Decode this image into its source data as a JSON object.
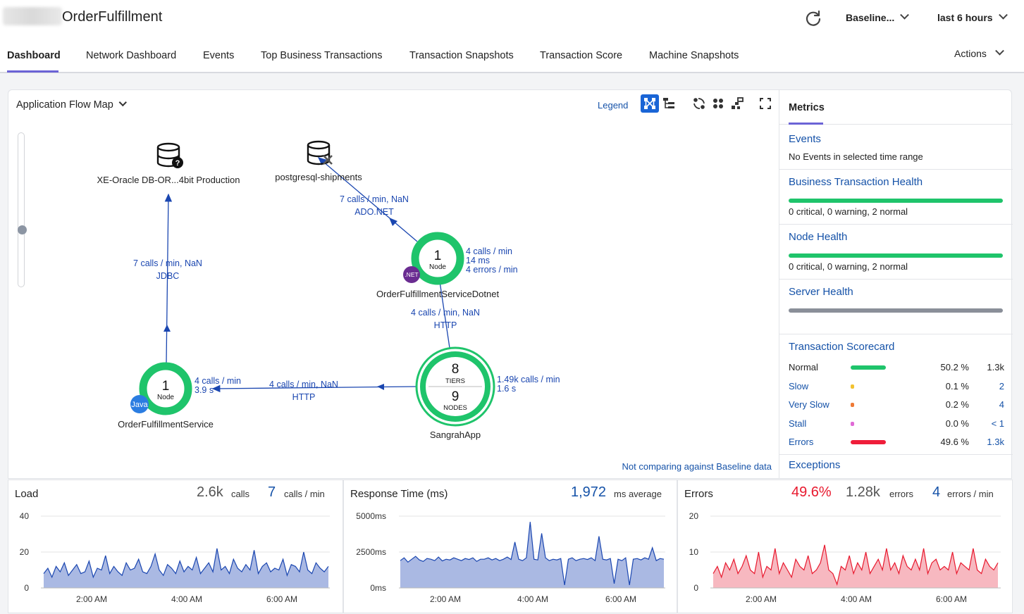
{
  "header": {
    "app_name": "OrderFulfillment",
    "baseline_label": "Baseline...",
    "time_range_label": "last 6 hours"
  },
  "tabs": [
    {
      "label": "Dashboard",
      "active": true
    },
    {
      "label": "Network Dashboard"
    },
    {
      "label": "Events"
    },
    {
      "label": "Top Business Transactions"
    },
    {
      "label": "Transaction Snapshots"
    },
    {
      "label": "Transaction Score"
    },
    {
      "label": "Machine Snapshots"
    }
  ],
  "actions_label": "Actions",
  "flowmap": {
    "title": "Application Flow Map",
    "legend_label": "Legend",
    "baseline_note": "Not comparing against Baseline data",
    "nodes": {
      "oracle_db": {
        "label": "XE-Oracle DB-OR...4bit Production"
      },
      "postgres": {
        "label": "postgresql-shipments"
      },
      "dotnet": {
        "count": "1",
        "unit": "Node",
        "badge": ".NET",
        "label": "OrderFulfillmentServiceDotnet",
        "stats": [
          "4 calls / min",
          "14 ms",
          "4 errors / min"
        ]
      },
      "java": {
        "count": "1",
        "unit": "Node",
        "badge": "Java",
        "label": "OrderFulfillmentService",
        "stats": [
          "4 calls / min",
          "3.9 s"
        ]
      },
      "sangrah": {
        "tiers": "8",
        "tiers_label": "TIERS",
        "nodes": "9",
        "nodes_label": "NODES",
        "label": "SangrahApp",
        "stats": [
          "1.49k calls / min",
          "1.6 s"
        ]
      }
    },
    "edges": {
      "java_to_oracle": [
        "7 calls / min, NaN",
        "JDBC"
      ],
      "dotnet_to_postgres": [
        "7 calls / min, NaN",
        "ADO.NET"
      ],
      "sangrah_to_dotnet": [
        "4 calls / min, NaN",
        "HTTP"
      ],
      "sangrah_to_java": [
        "4 calls / min, NaN",
        "HTTP"
      ]
    }
  },
  "metrics": {
    "header": "Metrics",
    "events": {
      "title": "Events",
      "subtitle": "No Events in selected time range"
    },
    "bt_health": {
      "title": "Business Transaction Health",
      "subtitle": "0 critical, 0 warning, 2 normal",
      "color": "#1fc46b"
    },
    "node_health": {
      "title": "Node Health",
      "subtitle": "0 critical, 0 warning, 2 normal",
      "color": "#1fc46b"
    },
    "server_health": {
      "title": "Server Health",
      "color": "#8a8f99"
    },
    "scorecard": {
      "title": "Transaction Scorecard",
      "rows": [
        {
          "name": "Normal",
          "percent": "50.2 %",
          "count": "1.3k",
          "color": "#1fc46b",
          "bar": 0.502
        },
        {
          "name": "Slow",
          "percent": "0.1 %",
          "count": "2",
          "color": "#f2c230",
          "bar": 0.001
        },
        {
          "name": "Very Slow",
          "percent": "0.2 %",
          "count": "4",
          "color": "#ef7a36",
          "bar": 0.002
        },
        {
          "name": "Stall",
          "percent": "0.0 %",
          "count": "< 1",
          "color": "#e06ad6",
          "bar": 0.0
        },
        {
          "name": "Errors",
          "percent": "49.6 %",
          "count": "1.3k",
          "color": "#ef1d3a",
          "bar": 0.496
        }
      ]
    },
    "exceptions": {
      "title": "Exceptions"
    }
  },
  "bottom": {
    "load": {
      "title": "Load",
      "total": "2.6k",
      "total_unit": "calls",
      "rate": "7",
      "rate_unit": "calls / min",
      "y_ticks": [
        "40",
        "20",
        "0"
      ],
      "x_ticks": [
        "2:00 AM",
        "4:00 AM",
        "6:00 AM"
      ],
      "color": "#1a46b0",
      "fill": "#aab9e3"
    },
    "response": {
      "title": "Response Time (ms)",
      "avg": "1,972",
      "avg_unit": "ms average",
      "y_ticks": [
        "5000ms",
        "2500ms",
        "0ms"
      ],
      "x_ticks": [
        "2:00 AM",
        "4:00 AM",
        "6:00 AM"
      ],
      "color": "#1a46b0",
      "fill": "#aab9e3"
    },
    "errors": {
      "title": "Errors",
      "percent": "49.6%",
      "total": "1.28k",
      "total_unit": "errors",
      "rate": "4",
      "rate_unit": "errors / min",
      "y_ticks": [
        "20",
        "10",
        "0"
      ],
      "x_ticks": [
        "2:00 AM",
        "4:00 AM",
        "6:00 AM"
      ],
      "color": "#e8192e",
      "fill": "#f7b8c0"
    }
  },
  "chart_data": [
    {
      "type": "area",
      "title": "Load",
      "ylim": [
        0,
        40
      ],
      "ylabel": "",
      "x_ticks": [
        "2:00 AM",
        "4:00 AM",
        "6:00 AM"
      ],
      "series": [
        {
          "values": [
            8,
            11,
            6,
            12,
            9,
            14,
            7,
            10,
            13,
            8,
            9,
            15,
            6,
            11,
            10,
            18,
            8,
            12,
            9,
            7,
            14,
            10,
            11,
            16,
            9,
            8,
            12,
            19,
            10,
            7,
            13,
            11,
            8,
            15,
            9,
            12,
            10,
            17,
            8,
            11,
            14,
            9,
            22,
            10,
            12,
            8,
            16,
            11,
            9,
            13,
            10,
            21,
            8,
            12,
            14,
            9,
            11,
            10,
            16,
            7,
            13,
            12,
            9,
            20,
            10,
            8,
            14,
            11,
            9,
            12
          ]
        }
      ]
    },
    {
      "type": "area",
      "title": "Response Time (ms)",
      "ylim": [
        0,
        5000
      ],
      "ylabel": "",
      "x_ticks": [
        "2:00 AM",
        "4:00 AM",
        "6:00 AM"
      ],
      "series": [
        {
          "values": [
            1900,
            2100,
            1800,
            2000,
            2200,
            1950,
            1850,
            2050,
            2000,
            1900,
            2150,
            1880,
            2000,
            1950,
            2100,
            2000,
            1900,
            2050,
            1980,
            2100,
            1850,
            2000,
            2000,
            2100,
            1950,
            2050,
            1900,
            2000,
            2150,
            1980,
            3200,
            2000,
            1900,
            2100,
            4600,
            2000,
            1950,
            3800,
            2100,
            1900,
            2000,
            1950,
            2050,
            200,
            2000,
            2100,
            1900,
            2000,
            2050,
            1980,
            2100,
            1900,
            3600,
            2000,
            1950,
            2050,
            300,
            2000,
            1900,
            2100,
            200,
            2000,
            2050,
            1950,
            2100,
            2000,
            2800,
            1900,
            2050,
            2000
          ]
        }
      ]
    },
    {
      "type": "area",
      "title": "Errors",
      "ylim": [
        0,
        20
      ],
      "ylabel": "",
      "x_ticks": [
        "2:00 AM",
        "4:00 AM",
        "6:00 AM"
      ],
      "series": [
        {
          "values": [
            4,
            6,
            3,
            7,
            5,
            8,
            4,
            6,
            9,
            5,
            4,
            10,
            3,
            6,
            5,
            11,
            4,
            7,
            5,
            3,
            8,
            6,
            5,
            9,
            4,
            5,
            7,
            12,
            5,
            4,
            1,
            6,
            5,
            9,
            4,
            7,
            5,
            10,
            4,
            6,
            8,
            5,
            11,
            5,
            7,
            4,
            9,
            6,
            5,
            8,
            5,
            11,
            4,
            7,
            8,
            5,
            6,
            5,
            10,
            4,
            7,
            6,
            5,
            11,
            5,
            4,
            8,
            6,
            5,
            7
          ]
        }
      ]
    }
  ]
}
